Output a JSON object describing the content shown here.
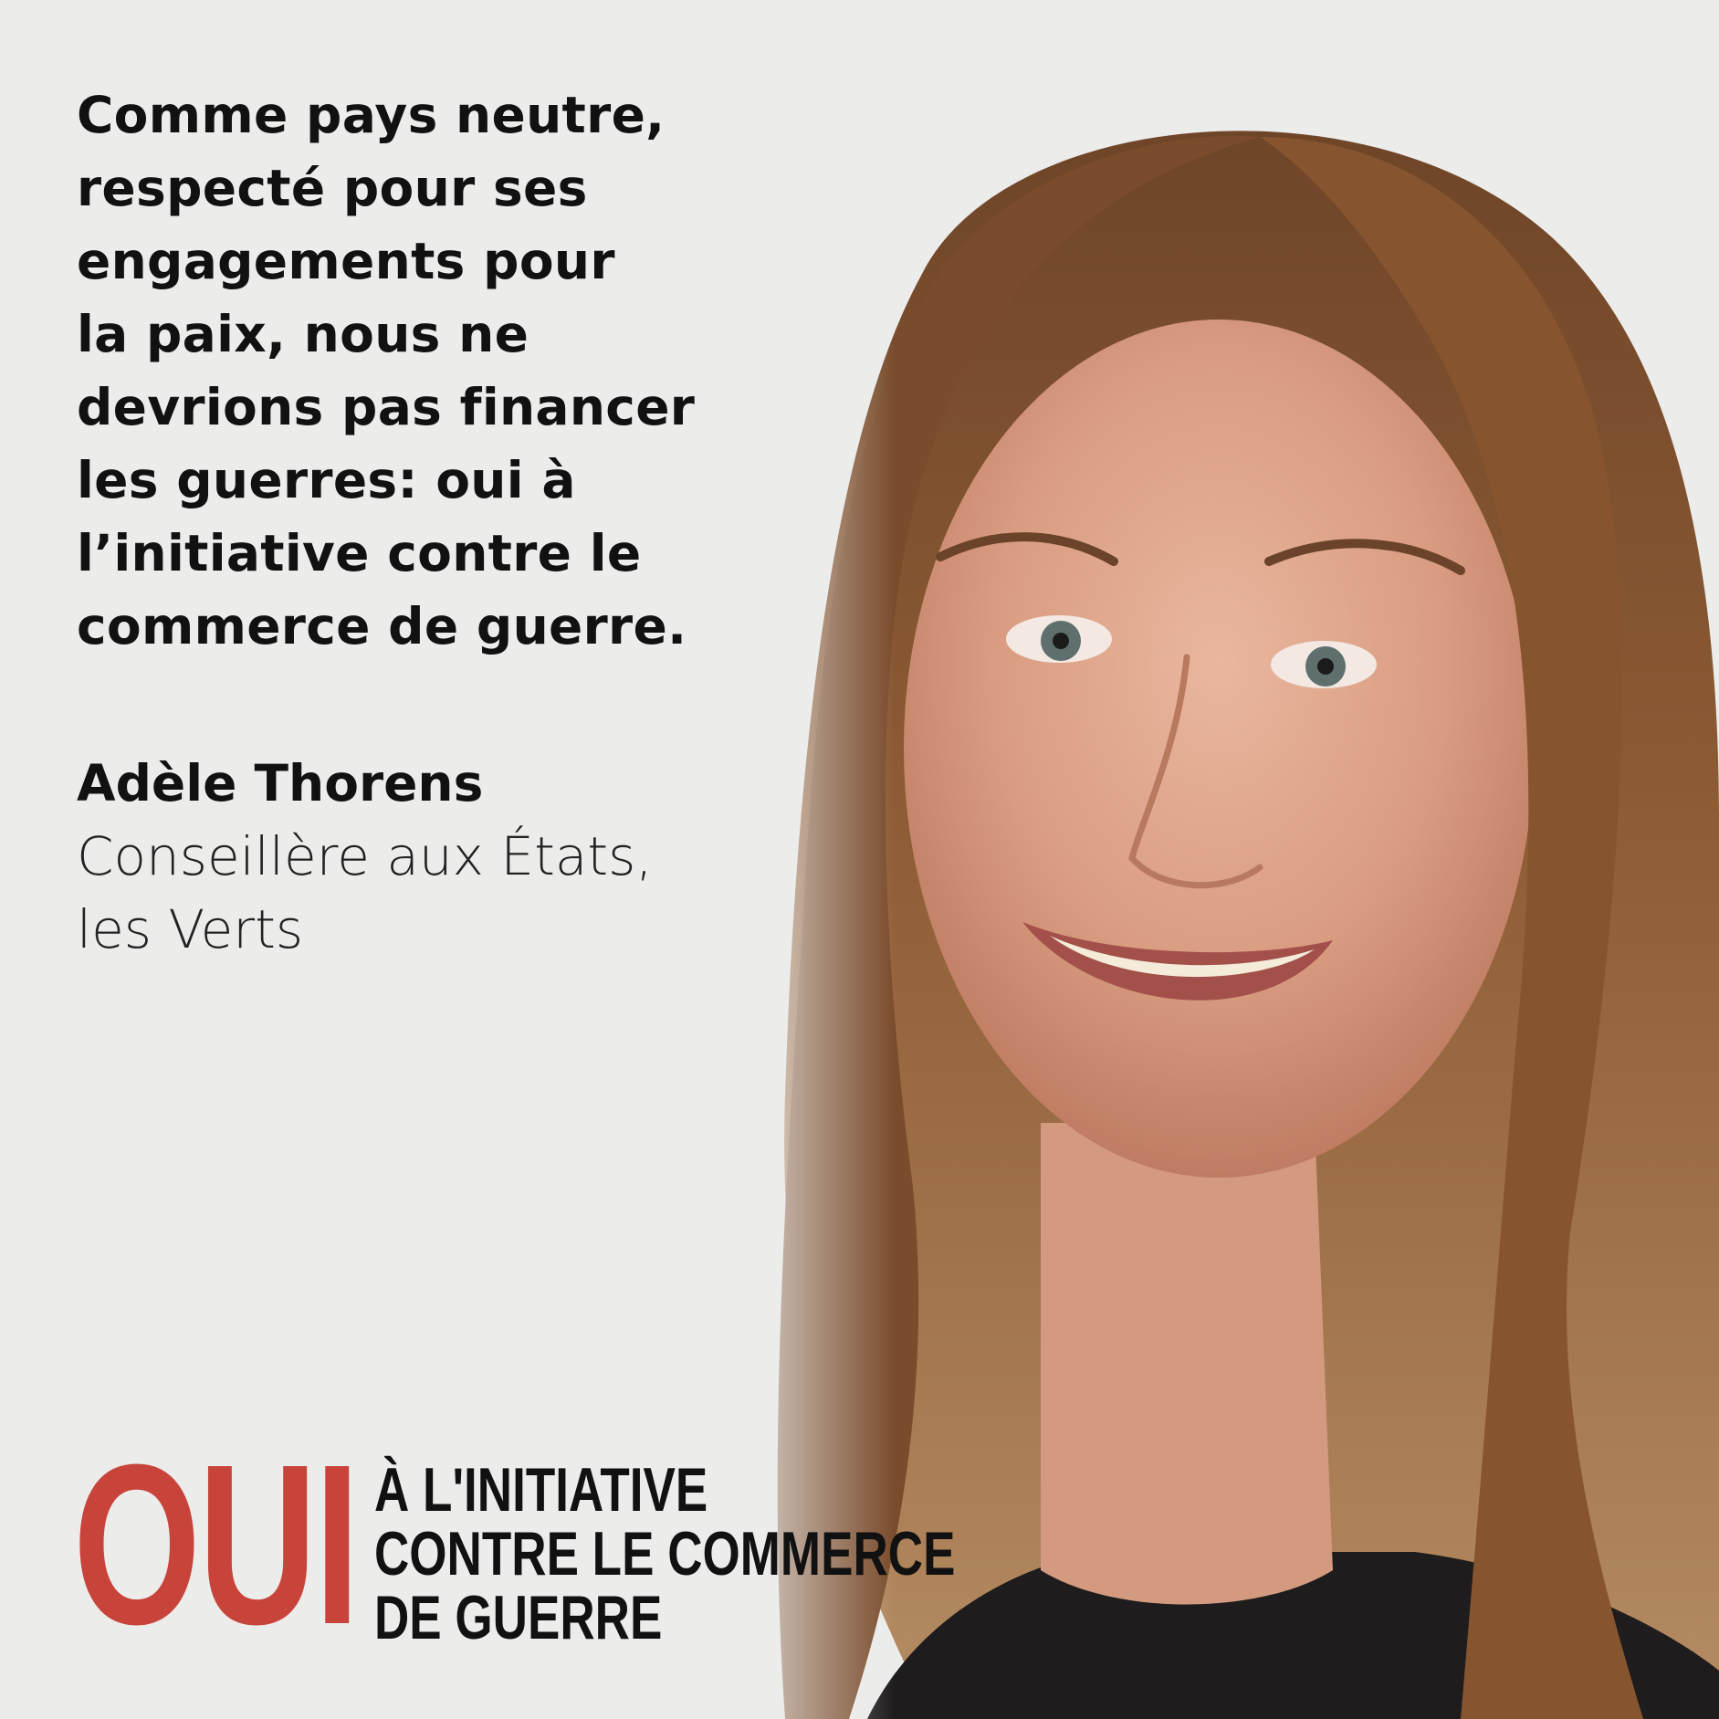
{
  "quote": {
    "lines": [
      "Comme pays neutre,",
      "respecté pour ses",
      "engagements pour",
      "la paix, nous ne",
      "devrions pas financer",
      "les guerres: oui à",
      "l’initiative contre le",
      "commerce de guerre."
    ]
  },
  "author": {
    "name": "Adèle Thorens",
    "role_lines": [
      "Conseillère aux États,",
      "les Verts"
    ]
  },
  "campaign": {
    "badge": "OUI",
    "slogan_lines": [
      "À L'INITIATIVE",
      "CONTRE LE COMMERCE",
      "DE GUERRE"
    ]
  },
  "colors": {
    "background": "#ececeb",
    "accent": "#c8443a",
    "text": "#111111",
    "hair": "#8a5a34",
    "skin": "#dfa58b"
  }
}
